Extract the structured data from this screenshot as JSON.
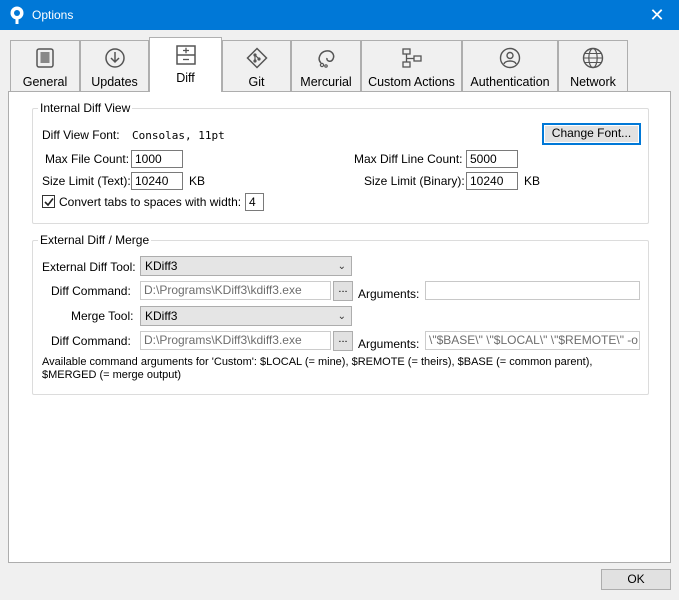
{
  "window": {
    "title": "Options",
    "close_icon": "close-icon"
  },
  "tabs": [
    {
      "label": "General",
      "icon": "toggle-switch-icon"
    },
    {
      "label": "Updates",
      "icon": "download-arrow-icon"
    },
    {
      "label": "Diff",
      "icon": "diff-compare-icon",
      "selected": true
    },
    {
      "label": "Git",
      "icon": "git-diamond-icon"
    },
    {
      "label": "Mercurial",
      "icon": "mercurial-drop-icon"
    },
    {
      "label": "Custom Actions",
      "icon": "flowchart-icon"
    },
    {
      "label": "Authentication",
      "icon": "user-account-icon"
    },
    {
      "label": "Network",
      "icon": "globe-icon"
    }
  ],
  "internal": {
    "group_title": "Internal Diff View",
    "font_label": "Diff View Font:",
    "font_value": "Consolas, 11pt",
    "change_font_button": "Change Font...",
    "max_file_count_label": "Max File Count:",
    "max_file_count_value": "1000",
    "max_diff_line_count_label": "Max Diff Line Count:",
    "max_diff_line_count_value": "5000",
    "size_limit_text_label": "Size Limit (Text):",
    "size_limit_text_value": "10240",
    "size_limit_text_unit": "KB",
    "size_limit_binary_label": "Size Limit (Binary):",
    "size_limit_binary_value": "10240",
    "size_limit_binary_unit": "KB",
    "convert_tabs_label": "Convert tabs to spaces with width:",
    "convert_tabs_checked": true,
    "convert_tabs_width": "4"
  },
  "external": {
    "group_title": "External Diff / Merge",
    "diff_tool_label": "External Diff Tool:",
    "diff_tool_value": "KDiff3",
    "diff_command_label": "Diff Command:",
    "diff_command_value": "D:\\Programs\\KDiff3\\kdiff3.exe",
    "browse_label": "...",
    "diff_arguments_label": "Arguments:",
    "diff_arguments_value": "",
    "merge_tool_label": "Merge Tool:",
    "merge_tool_value": "KDiff3",
    "merge_command_label": "Diff Command:",
    "merge_command_value": "D:\\Programs\\KDiff3\\kdiff3.exe",
    "merge_arguments_label": "Arguments:",
    "merge_arguments_value": "\\\"$BASE\\\" \\\"$LOCAL\\\" \\\"$REMOTE\\\" -o",
    "help_text_line1": "Available command arguments for 'Custom': $LOCAL (= mine), $REMOTE (= theirs), $BASE (= common parent),",
    "help_text_line2": "$MERGED (= merge output)"
  },
  "footer": {
    "ok_button": "OK"
  },
  "colors": {
    "titlebar": "#0078d7",
    "focus": "#0078d7"
  }
}
